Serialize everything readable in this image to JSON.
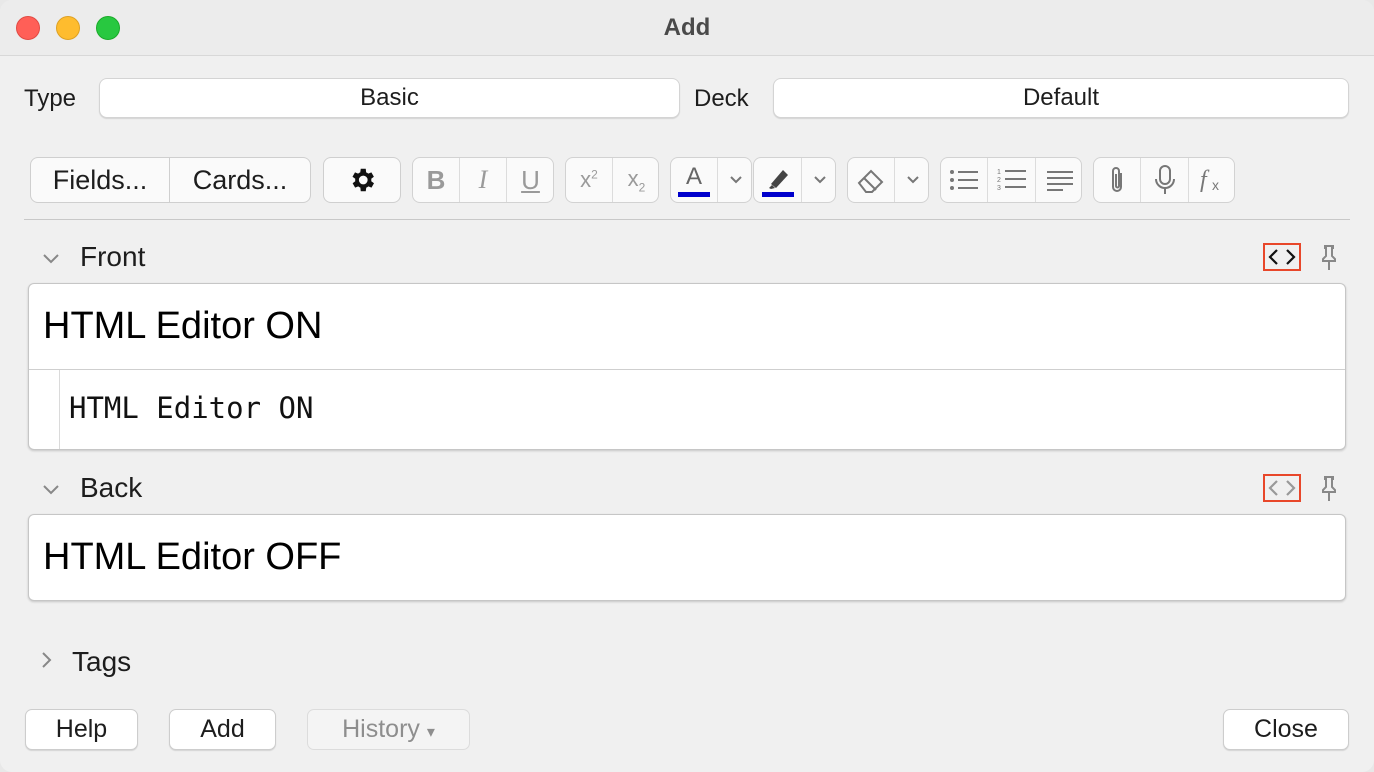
{
  "window": {
    "title": "Add"
  },
  "selectors": {
    "type_label": "Type",
    "type_value": "Basic",
    "deck_label": "Deck",
    "deck_value": "Default"
  },
  "toolbar": {
    "fields_label": "Fields...",
    "cards_label": "Cards...",
    "icons": [
      "gear-icon",
      "bold-icon",
      "italic-icon",
      "underline-icon",
      "superscript-icon",
      "subscript-icon",
      "text-color-icon",
      "dropdown-icon",
      "highlight-icon",
      "dropdown-icon",
      "eraser-icon",
      "dropdown-icon",
      "bullet-list-icon",
      "numbered-list-icon",
      "align-icon",
      "paperclip-icon",
      "microphone-icon",
      "formula-icon"
    ],
    "text_color": "#0000cc",
    "highlight_color": "#0000cc"
  },
  "fields": [
    {
      "name": "Front",
      "value": "HTML Editor ON",
      "html_editor_open": true,
      "html_code": "HTML Editor ON"
    },
    {
      "name": "Back",
      "value": "HTML Editor OFF",
      "html_editor_open": false
    }
  ],
  "tags": {
    "label": "Tags"
  },
  "buttons": {
    "help": "Help",
    "add": "Add",
    "history": "History",
    "history_arrow": "▾",
    "close": "Close"
  },
  "colors": {
    "highlight_box": "#e8472a"
  }
}
